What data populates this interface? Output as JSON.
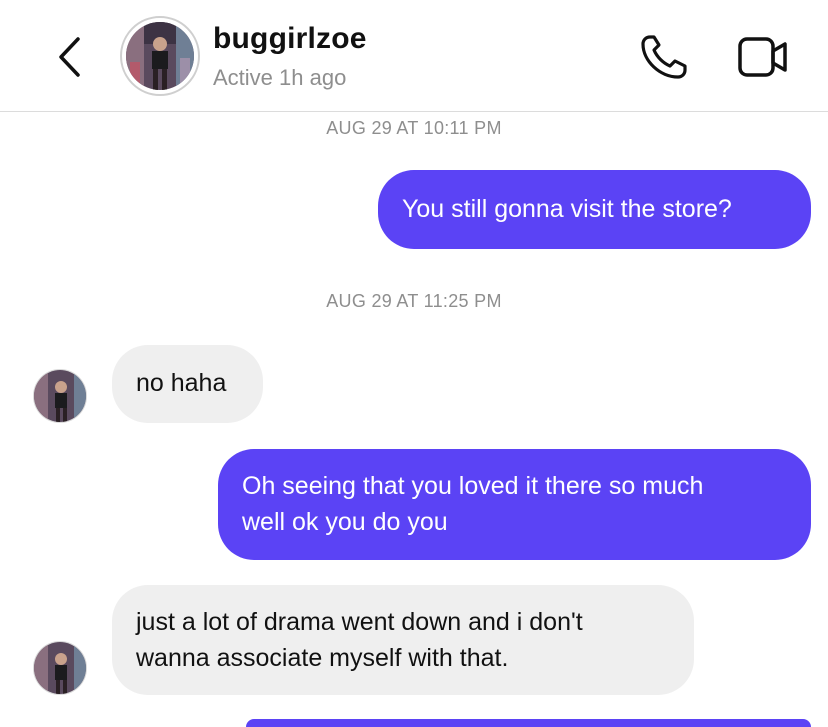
{
  "header": {
    "name": "buggirlzoe",
    "status": "Active 1h ago"
  },
  "colors": {
    "outgoing_bubble": "#5b43f5",
    "incoming_bubble": "#efefef",
    "timestamp_text": "#8e8e8e"
  },
  "icons": {
    "back": "chevron-left-icon",
    "call": "phone-icon",
    "video": "video-camera-icon"
  },
  "timestamps": [
    "AUG 29 AT 10:11 PM",
    "AUG 29 AT 11:25 PM"
  ],
  "messages": [
    {
      "direction": "outgoing",
      "text": "You still gonna visit the store?"
    },
    {
      "direction": "incoming",
      "text": "no haha"
    },
    {
      "direction": "outgoing",
      "lines": [
        "Oh seeing that you loved it there so much",
        "well ok you do you"
      ]
    },
    {
      "direction": "incoming",
      "lines": [
        "just a lot of drama went down and i don't",
        "wanna associate myself with that."
      ]
    }
  ]
}
